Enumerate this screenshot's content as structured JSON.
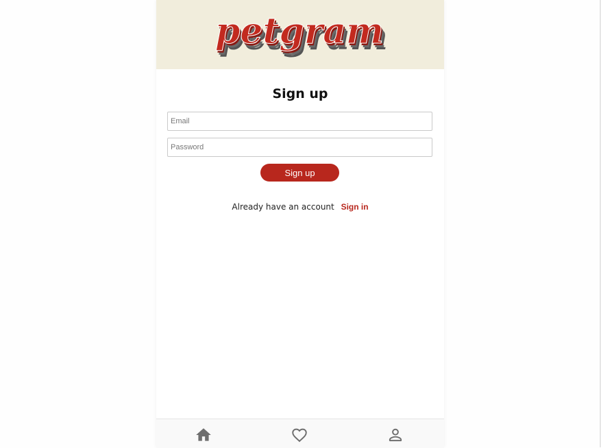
{
  "app": {
    "logo_text": "petgram",
    "brand_color": "#b8271d",
    "header_bg": "#f1eddc"
  },
  "form": {
    "title": "Sign up",
    "email_placeholder": "Email",
    "email_value": "",
    "password_placeholder": "Password",
    "password_value": "",
    "submit_label": "Sign up"
  },
  "signin": {
    "prompt": "Already have an account",
    "link_label": "Sign in"
  },
  "navbar": {
    "items": [
      {
        "icon": "home-icon"
      },
      {
        "icon": "heart-icon"
      },
      {
        "icon": "user-icon"
      }
    ]
  }
}
